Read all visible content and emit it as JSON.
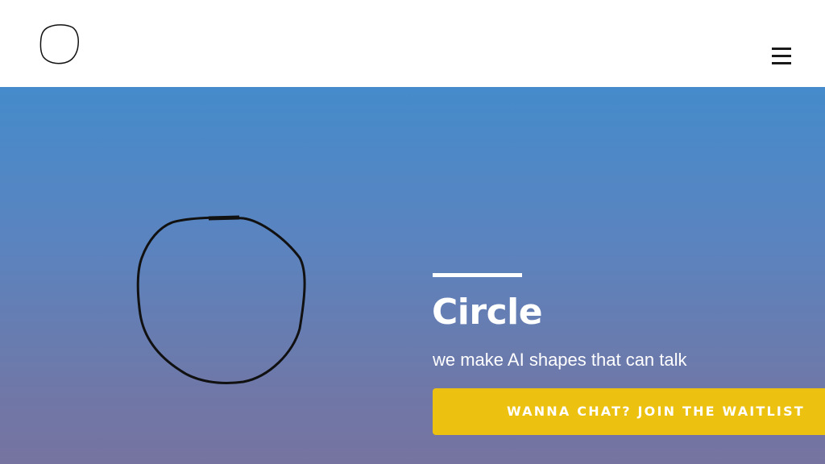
{
  "header": {
    "logo_icon": "circle-icon",
    "menu_icon": "hamburger-menu-icon"
  },
  "hero": {
    "title": "Circle",
    "subtitle": "we make AI shapes that can talk",
    "cta_label": "WANNA CHAT? JOIN THE WAITLIST",
    "shape_icon": "hand-drawn-circle-icon"
  },
  "colors": {
    "header_background": "#ffffff",
    "hero_gradient_top": "#458bcb",
    "hero_gradient_bottom": "#7673a0",
    "cta_background": "#ecc10f",
    "text": "#ffffff",
    "stroke": "#111111"
  }
}
